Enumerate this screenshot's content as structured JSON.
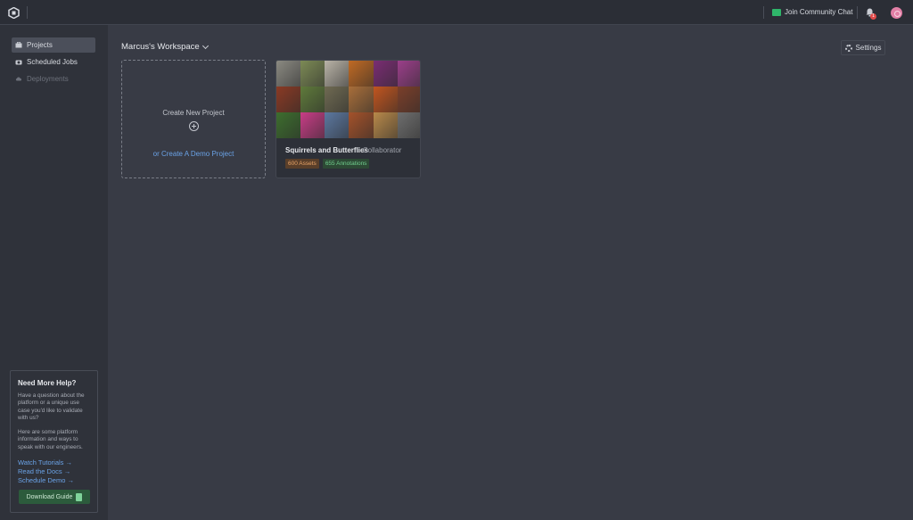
{
  "topbar": {
    "chat_label": "Join Community Chat",
    "notification_count": "1"
  },
  "sidebar": {
    "items": [
      {
        "label": "Projects",
        "icon": "briefcase-icon",
        "active": true
      },
      {
        "label": "Scheduled Jobs",
        "icon": "camera-icon",
        "active": false
      },
      {
        "label": "Deployments",
        "icon": "cloud-upload-icon",
        "active": false,
        "disabled": true
      }
    ],
    "help": {
      "title": "Need More Help?",
      "paragraph1": "Have a question about the platform or a unique use case you'd like to validate with us?",
      "paragraph2": "Here are some platform information and ways to speak with our engineers.",
      "links": [
        "Watch Tutorials →",
        "Read the Docs →",
        "Schedule Demo →"
      ],
      "button_label": "Download Guide"
    }
  },
  "main": {
    "workspace_label": "Marcus's Workspace",
    "settings_label": "Settings",
    "create_card": {
      "title": "Create New Project",
      "demo_link": "or Create A Demo Project"
    },
    "projects": [
      {
        "title": "Squirrels and Butterflies",
        "role": "· Collaborator",
        "assets": "600 Assets",
        "annotations": "655 Annotations",
        "tile_colors": [
          "#8b8a82",
          "#7c8a55",
          "#b9b3a7",
          "#c06a24",
          "#7a2d73",
          "#9b3f8a",
          "#8a3a24",
          "#5f7a3b",
          "#6f6a52",
          "#a86e3a",
          "#c1551f",
          "#7b3f2a",
          "#3d6e2e",
          "#c83d86",
          "#5c78a0",
          "#a4522a",
          "#b8894a",
          "#6e6e6e"
        ]
      }
    ]
  },
  "colors": {
    "accent_link": "#6aa2e6",
    "assets_badge": "#e8a468",
    "annotations_badge": "#72d08f"
  }
}
